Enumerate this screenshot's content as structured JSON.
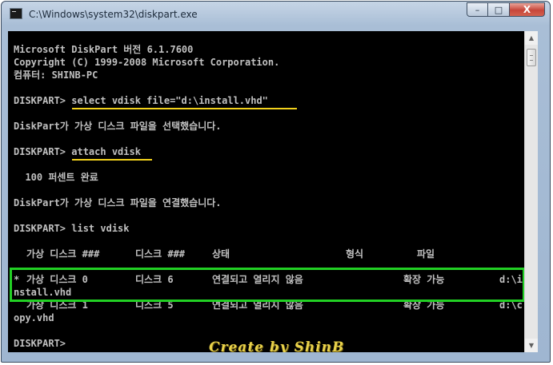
{
  "window": {
    "title": "C:\\Windows\\system32\\diskpart.exe",
    "controls": {
      "minimize": "–",
      "maximize": "□",
      "close": "X"
    }
  },
  "console": {
    "header": [
      "Microsoft DiskPart 버전 6.1.7600",
      "Copyright (C) 1999-2008 Microsoft Corporation.",
      "컴퓨터: SHINB-PC"
    ],
    "prompt": "DISKPART> ",
    "cmd1": "select vdisk file=\"d:\\install.vhd\"",
    "msg1": "DiskPart가 가상 디스크 파일을 선택했습니다.",
    "cmd2": "attach vdisk",
    "progress": "  100 퍼센트 완료",
    "msg2": "DiskPart가 가상 디스크 파일을 연결했습니다.",
    "cmd3": "list vdisk",
    "table_headers": {
      "virtual_disk": "가상 디스크 ###",
      "disk": "디스크 ###",
      "state": "상태",
      "type": "형식",
      "file": "파일"
    },
    "rows": [
      {
        "marker": "*",
        "virtual_disk": "가상 디스크 0",
        "disk": "디스크 6",
        "state": "연결되고 열리지 않음",
        "type": "확장 가능",
        "file_start": "d:\\i",
        "file_rest": "nstall.vhd"
      },
      {
        "marker": "",
        "virtual_disk": "가상 디스크 1",
        "disk": "디스크 5",
        "state": "연결되고 열리지 않음",
        "type": "확장 가능",
        "file_start": "d:\\c",
        "file_rest": "opy.vhd"
      }
    ],
    "final_prompt": "DISKPART> "
  },
  "watermark": "Create by ShinB",
  "colors": {
    "console_bg": "#000000",
    "console_text": "#c0c0c0",
    "underline": "#f2d11c",
    "highlight_box": "#22d024",
    "watermark": "#e9d24b"
  }
}
